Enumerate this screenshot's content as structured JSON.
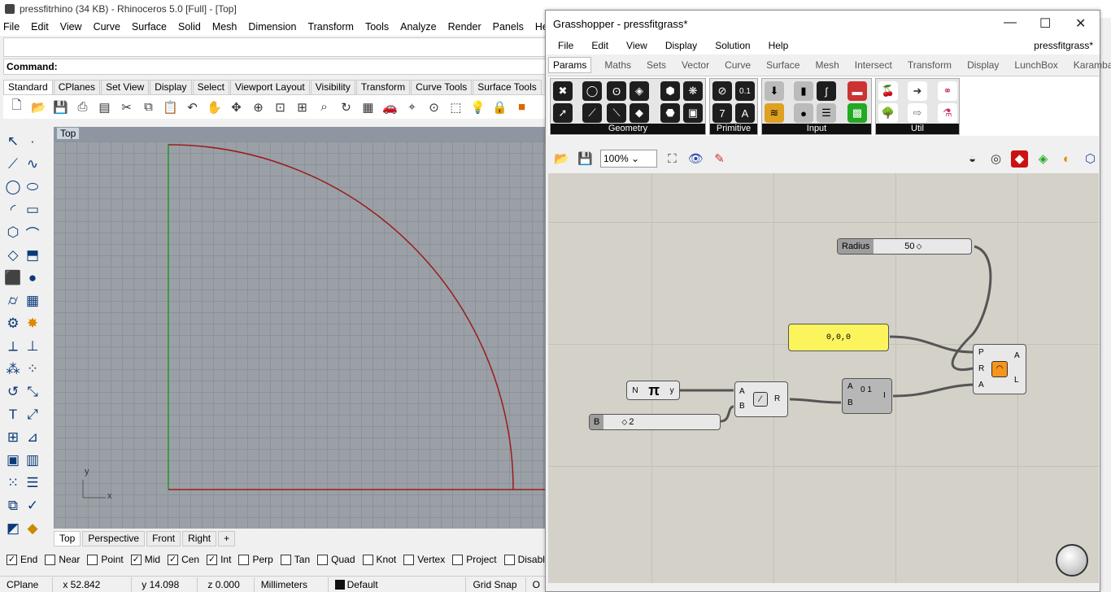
{
  "rhino": {
    "title": "pressfitrhino (34 KB) - Rhinoceros 5.0 [Full] - [Top]",
    "menu": [
      "File",
      "Edit",
      "View",
      "Curve",
      "Surface",
      "Solid",
      "Mesh",
      "Dimension",
      "Transform",
      "Tools",
      "Analyze",
      "Render",
      "Panels",
      "Help"
    ],
    "command_label": "Command:",
    "toolbar_tabs": [
      "Standard",
      "CPlanes",
      "Set View",
      "Display",
      "Select",
      "Viewport Layout",
      "Visibility",
      "Transform",
      "Curve Tools",
      "Surface Tools"
    ],
    "viewport_title": "Top",
    "viewport_tabs": [
      "Top",
      "Perspective",
      "Front",
      "Right"
    ],
    "axis_y": "y",
    "axis_x": "x",
    "osnaps": [
      {
        "label": "End",
        "checked": true
      },
      {
        "label": "Near",
        "checked": false
      },
      {
        "label": "Point",
        "checked": false
      },
      {
        "label": "Mid",
        "checked": true
      },
      {
        "label": "Cen",
        "checked": true
      },
      {
        "label": "Int",
        "checked": true
      },
      {
        "label": "Perp",
        "checked": false
      },
      {
        "label": "Tan",
        "checked": false
      },
      {
        "label": "Quad",
        "checked": false
      },
      {
        "label": "Knot",
        "checked": false
      },
      {
        "label": "Vertex",
        "checked": false
      },
      {
        "label": "Project",
        "checked": false
      },
      {
        "label": "Disable",
        "checked": false
      }
    ],
    "status": {
      "cplane": "CPlane",
      "x": "x 52.842",
      "y": "y 14.098",
      "z": "z 0.000",
      "units": "Millimeters",
      "layer": "Default",
      "grid_snap": "Grid Snap",
      "extra": "O"
    },
    "colors": {
      "curve": "#9b1c1c",
      "y_axis": "#1f9a2a",
      "x_axis": "#9b1c1c"
    }
  },
  "gh": {
    "title": "Grasshopper - pressfitgrass*",
    "menu": [
      "File",
      "Edit",
      "View",
      "Display",
      "Solution",
      "Help"
    ],
    "doc_name": "pressfitgrass*",
    "component_tabs": [
      "Params",
      "Maths",
      "Sets",
      "Vector",
      "Curve",
      "Surface",
      "Mesh",
      "Intersect",
      "Transform",
      "Display",
      "LunchBox",
      "Karamba"
    ],
    "groups": [
      "Geometry",
      "Primitive",
      "Input",
      "Util"
    ],
    "zoom": "100%",
    "nodes": {
      "radius_label": "Radius",
      "radius_value": "50",
      "panel_text": "0,0,0",
      "pi_n": "N",
      "pi_symbol": "π",
      "pi_y": "y",
      "b_label": "B",
      "b_value": "2",
      "div_a": "A",
      "div_b": "B",
      "div_r": "R",
      "dom_a": "A",
      "dom_b": "B",
      "dom_i": "I",
      "dom_icon": "0 1",
      "arc_p": "P",
      "arc_r": "R",
      "arc_a": "A",
      "arc_out_a": "A",
      "arc_out_l": "L"
    }
  }
}
